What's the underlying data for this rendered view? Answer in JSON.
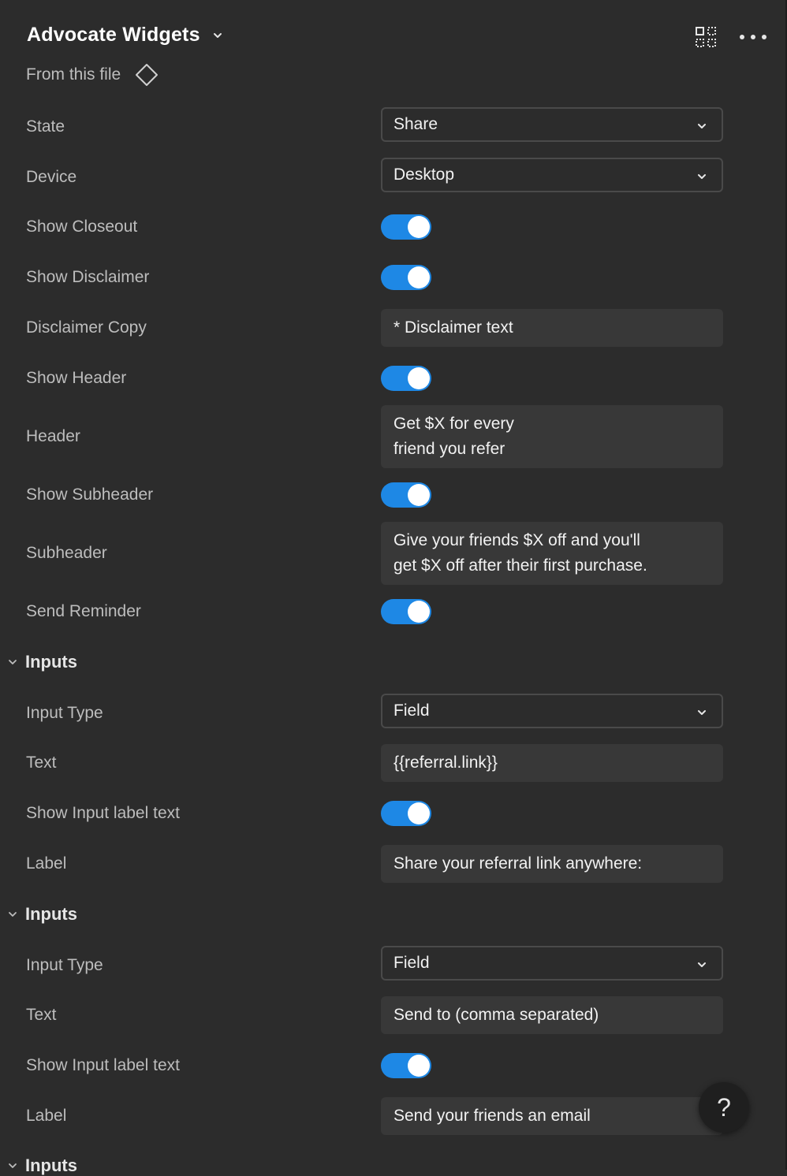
{
  "header": {
    "title": "Advocate Widgets",
    "source_label": "From this file"
  },
  "icons": {
    "title_chevron": "chevron-down-icon",
    "grid": "grid-icon",
    "more": "more-icon",
    "component": "diamond-icon",
    "help": "help-icon"
  },
  "accent_color": "#1e88e5",
  "rows": {
    "state": {
      "label": "State",
      "value": "Share"
    },
    "device": {
      "label": "Device",
      "value": "Desktop"
    },
    "show_closeout": {
      "label": "Show Closeout",
      "on": true
    },
    "show_disclaimer": {
      "label": "Show Disclaimer",
      "on": true
    },
    "disclaimer_copy": {
      "label": "Disclaimer Copy",
      "value": "* Disclaimer text"
    },
    "show_header": {
      "label": "Show Header",
      "on": true
    },
    "header": {
      "label": "Header",
      "line1": "Get $X for every",
      "line2": "friend you refer"
    },
    "show_subheader": {
      "label": "Show Subheader",
      "on": true
    },
    "subheader": {
      "label": "Subheader",
      "line1": "Give your friends $X off and you'll",
      "line2": "get $X off after their first purchase."
    },
    "send_reminder": {
      "label": "Send Reminder",
      "on": true
    }
  },
  "inputs_1": {
    "section_label": "Inputs",
    "input_type": {
      "label": "Input Type",
      "value": "Field"
    },
    "text": {
      "label": "Text",
      "value": "{{referral.link}}"
    },
    "show_label": {
      "label": "Show Input label text",
      "on": true
    },
    "label": {
      "label": "Label",
      "value": "Share your referral link anywhere:"
    }
  },
  "inputs_2": {
    "section_label": "Inputs",
    "input_type": {
      "label": "Input Type",
      "value": "Field"
    },
    "text": {
      "label": "Text",
      "value": "Send to (comma separated)"
    },
    "show_label": {
      "label": "Show Input label text",
      "on": true
    },
    "label": {
      "label": "Label",
      "value": "Send your friends an email"
    }
  },
  "inputs_3": {
    "section_label": "Inputs"
  },
  "help": {
    "symbol": "?"
  }
}
